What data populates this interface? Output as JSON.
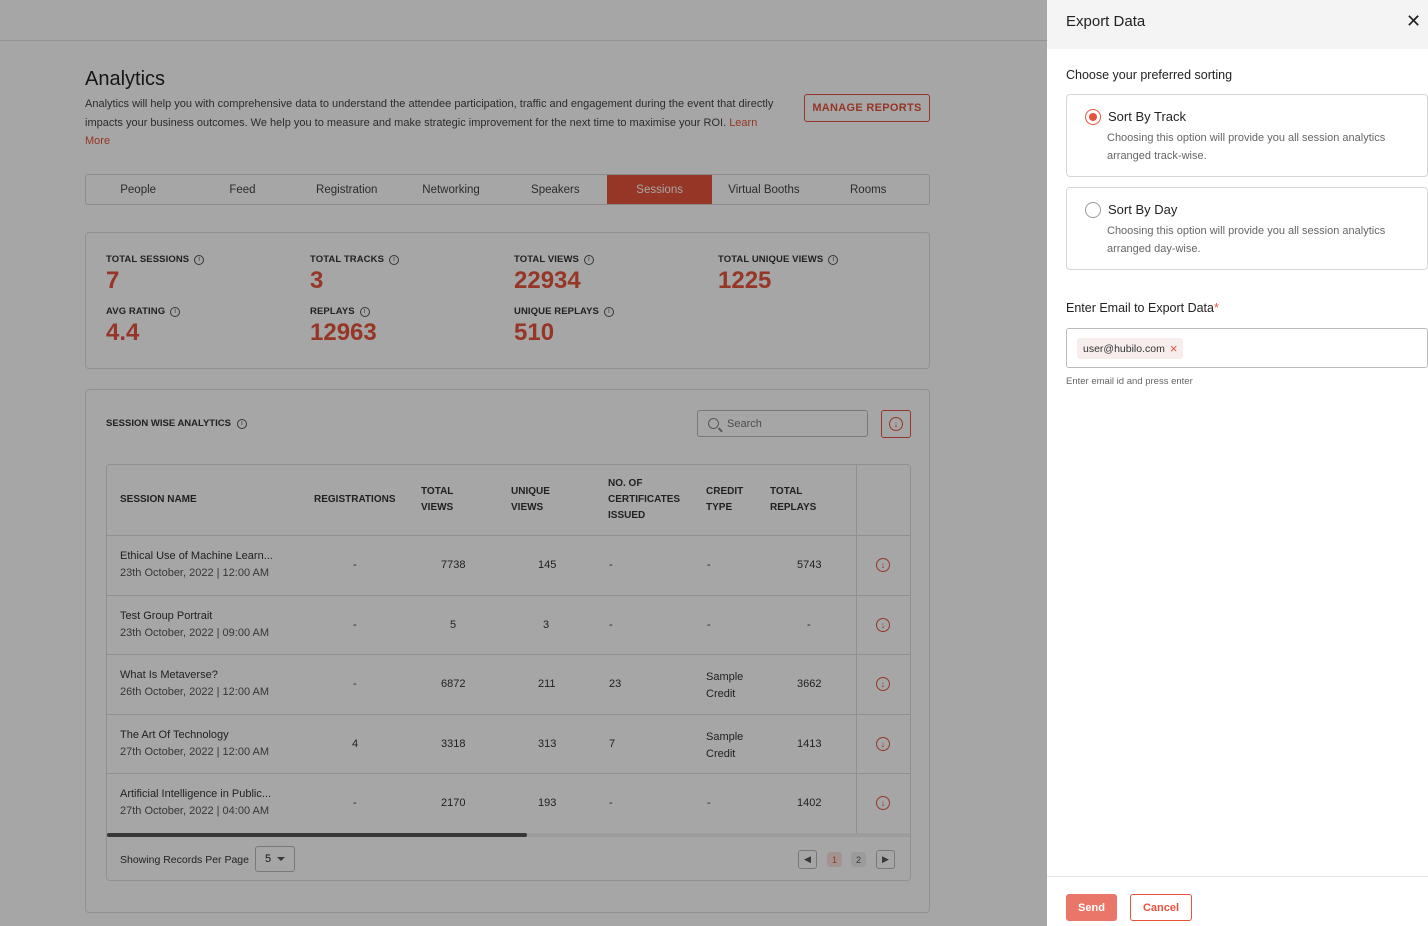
{
  "analytics": {
    "title": "Analytics",
    "description": "Analytics will help you with comprehensive data to understand the attendee participation, traffic and engagement during the event that directly impacts your business outcomes. We help you to measure and make strategic improvement for the next time to maximise your ROI.",
    "learn_more": "Learn More",
    "manage_reports": "MANAGE REPORTS"
  },
  "tabs": [
    "People",
    "Feed",
    "Registration",
    "Networking",
    "Speakers",
    "Sessions",
    "Virtual Booths",
    "Rooms"
  ],
  "active_tab": "Sessions",
  "stats": [
    {
      "label": "TOTAL SESSIONS",
      "value": "7"
    },
    {
      "label": "TOTAL TRACKS",
      "value": "3"
    },
    {
      "label": "TOTAL VIEWS",
      "value": "22934"
    },
    {
      "label": "TOTAL UNIQUE VIEWS",
      "value": "1225"
    },
    {
      "label": "AVG RATING",
      "value": "4.4"
    },
    {
      "label": "REPLAYS",
      "value": "12963"
    },
    {
      "label": "UNIQUE REPLAYS",
      "value": "510"
    }
  ],
  "session_wise": {
    "title": "SESSION WISE ANALYTICS",
    "search_placeholder": "Search",
    "columns": [
      "SESSION NAME",
      "REGISTRATIONS",
      "TOTAL VIEWS",
      "UNIQUE VIEWS",
      "NO. OF CERTIFICATES ISSUED",
      "CREDIT TYPE",
      "TOTAL REPLAYS"
    ],
    "rows": [
      {
        "name": "Ethical Use of Machine Learn...",
        "date": "23th October, 2022 | 12:00 AM",
        "registrations": "-",
        "total_views": "7738",
        "unique_views": "145",
        "certificates": "-",
        "credit_type": "-",
        "total_replays": "5743"
      },
      {
        "name": "Test Group Portrait",
        "date": "23th October, 2022 | 09:00 AM",
        "registrations": "-",
        "total_views": "5",
        "unique_views": "3",
        "certificates": "-",
        "credit_type": "-",
        "total_replays": "-"
      },
      {
        "name": "What Is Metaverse?",
        "date": "26th October, 2022 | 12:00 AM",
        "registrations": "-",
        "total_views": "6872",
        "unique_views": "211",
        "certificates": "23",
        "credit_type": "Sample Credit",
        "total_replays": "3662"
      },
      {
        "name": "The Art Of Technology",
        "date": "27th October, 2022 | 12:00 AM",
        "registrations": "4",
        "total_views": "3318",
        "unique_views": "313",
        "certificates": "7",
        "credit_type": "Sample Credit",
        "total_replays": "1413"
      },
      {
        "name": "Artificial Intelligence in Public...",
        "date": "27th October, 2022 | 04:00 AM",
        "registrations": "-",
        "total_views": "2170",
        "unique_views": "193",
        "certificates": "-",
        "credit_type": "-",
        "total_replays": "1402"
      }
    ],
    "records_label": "Showing Records Per Page",
    "per_page": "5",
    "pages": [
      "1",
      "2"
    ],
    "current_page": "1"
  },
  "drawer": {
    "title": "Export Data",
    "choose_label": "Choose your preferred sorting",
    "options": [
      {
        "title": "Sort By Track",
        "desc": "Choosing this option will provide you all session analytics arranged track-wise.",
        "selected": true
      },
      {
        "title": "Sort By Day",
        "desc": "Choosing this option will provide you all session analytics arranged day-wise.",
        "selected": false
      }
    ],
    "email_label": "Enter Email to Export Data",
    "required_mark": "*",
    "email_chip": "user@hubilo.com",
    "hint": "Enter email id and press enter",
    "send": "Send",
    "cancel": "Cancel"
  },
  "colors": {
    "accent": "#e5533d",
    "overlay": "rgba(0,0,0,0.35)"
  }
}
